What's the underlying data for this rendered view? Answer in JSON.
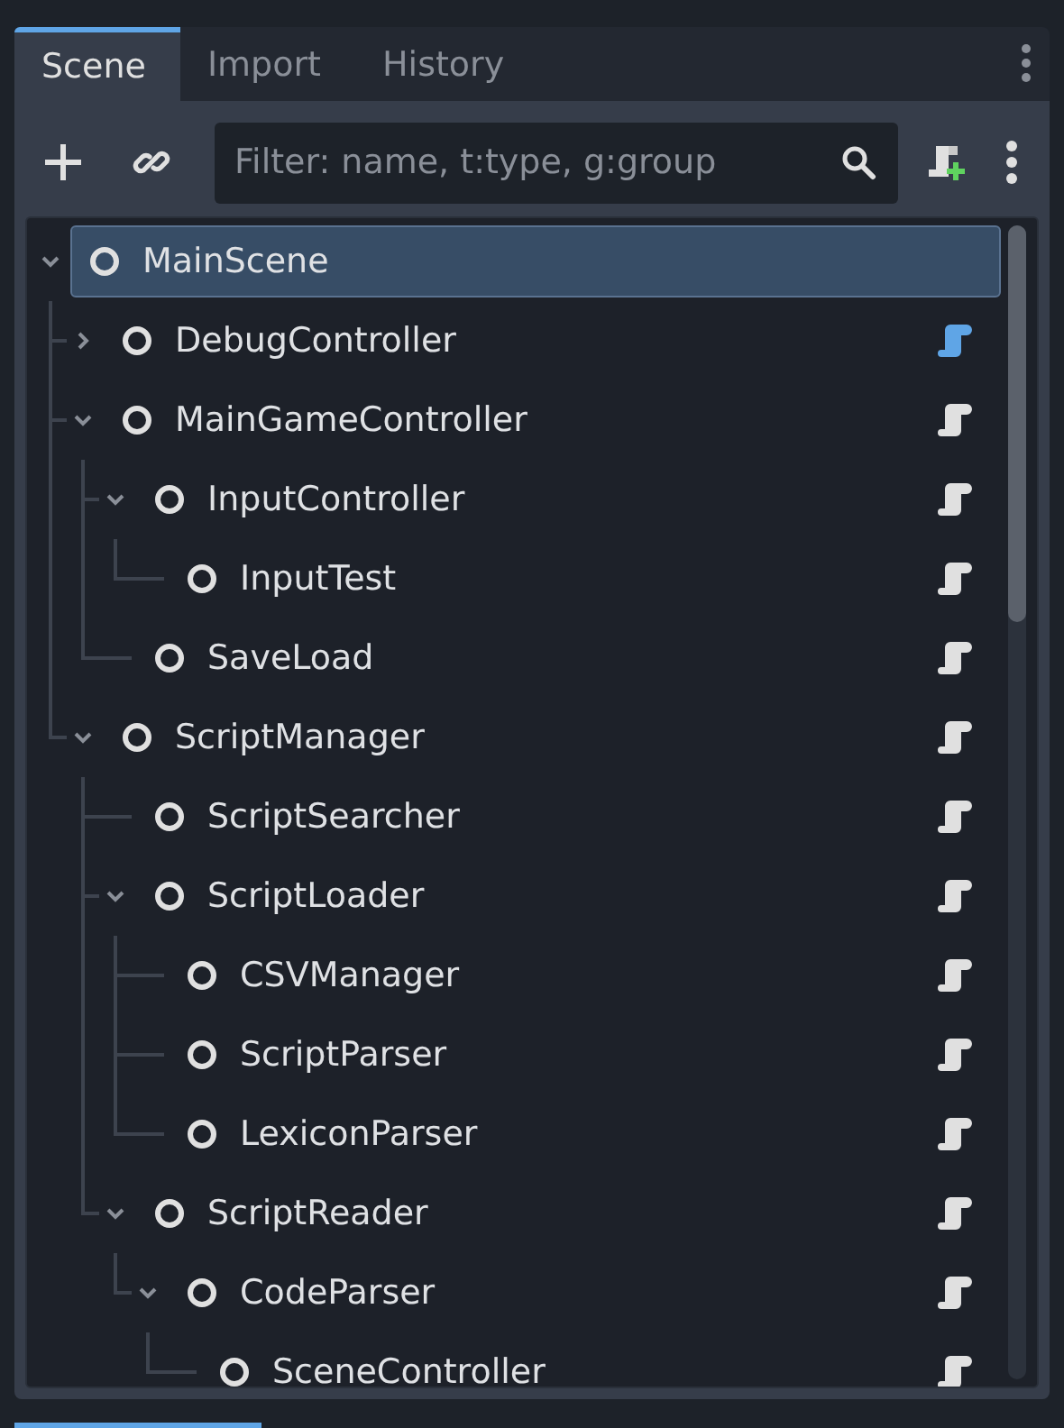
{
  "tabs": [
    {
      "label": "Scene",
      "selected": true
    },
    {
      "label": "Import",
      "selected": false
    },
    {
      "label": "History",
      "selected": false
    }
  ],
  "filter": {
    "placeholder": "Filter: name, t:type, g:group"
  },
  "tree": [
    {
      "name": "MainScene",
      "selected": true,
      "expanded": true,
      "children": [
        {
          "name": "DebugController",
          "selected": false,
          "expanded": false,
          "color": "#5fa5e6"
        },
        {
          "name": "MainGameController",
          "selected": false,
          "expanded": true,
          "color": "#e0e0e0",
          "children": [
            {
              "name": "InputController",
              "selected": false,
              "expanded": true,
              "color": "#e0e0e0",
              "children": [
                {
                  "name": "InputTest",
                  "selected": false,
                  "color": "#e0e0e0"
                }
              ]
            },
            {
              "name": "SaveLoad",
              "selected": false,
              "color": "#e0e0e0"
            }
          ]
        },
        {
          "name": "ScriptManager",
          "selected": false,
          "expanded": true,
          "color": "#e0e0e0",
          "children": [
            {
              "name": "ScriptSearcher",
              "selected": false,
              "color": "#e0e0e0"
            },
            {
              "name": "ScriptLoader",
              "selected": false,
              "expanded": true,
              "color": "#e0e0e0",
              "children": [
                {
                  "name": "CSVManager",
                  "selected": false,
                  "color": "#e0e0e0"
                },
                {
                  "name": "ScriptParser",
                  "selected": false,
                  "color": "#e0e0e0"
                },
                {
                  "name": "LexiconParser",
                  "selected": false,
                  "color": "#e0e0e0"
                }
              ]
            },
            {
              "name": "ScriptReader",
              "selected": false,
              "expanded": true,
              "color": "#e0e0e0",
              "children": [
                {
                  "name": "CodeParser",
                  "selected": false,
                  "expanded": true,
                  "color": "#e0e0e0",
                  "children": [
                    {
                      "name": "SceneController",
                      "selected": false,
                      "color": "#e0e0e0"
                    }
                  ]
                }
              ]
            }
          ]
        }
      ]
    }
  ]
}
